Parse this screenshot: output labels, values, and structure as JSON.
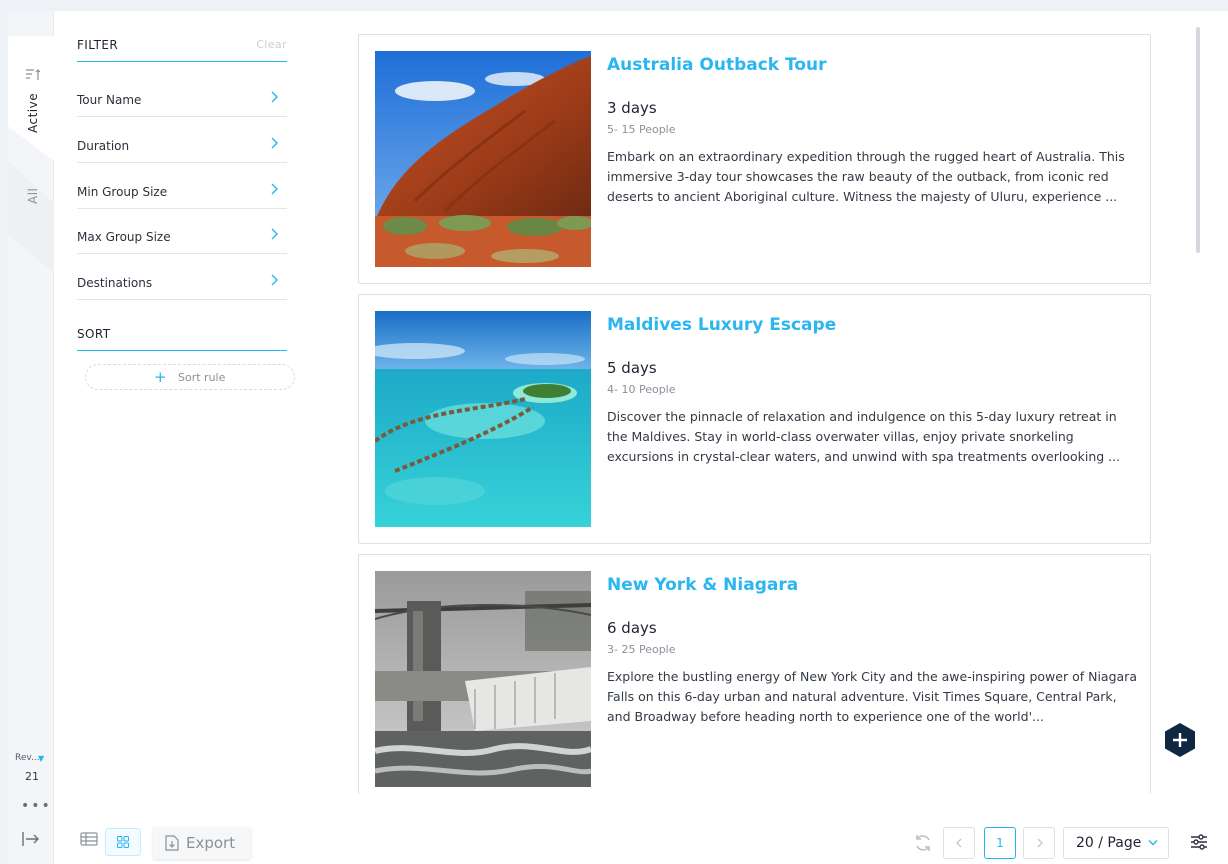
{
  "rail": {
    "tab_active": "Active",
    "tab_all": "All",
    "rev_label": "Rev...",
    "rev_value": "21",
    "more": "•••"
  },
  "filter": {
    "heading": "FILTER",
    "clear": "Clear",
    "items": [
      {
        "label": "Tour Name"
      },
      {
        "label": "Duration"
      },
      {
        "label": "Min Group Size"
      },
      {
        "label": "Max Group Size"
      },
      {
        "label": "Destinations"
      }
    ]
  },
  "sort": {
    "heading": "SORT",
    "add_rule": "Sort rule"
  },
  "tours": [
    {
      "title": "Australia Outback Tour",
      "duration": "3 days",
      "group": "5- 15 People",
      "description": "Embark on an extraordinary expedition through the rugged heart of Australia. This immersive 3-day tour showcases the raw beauty of the outback, from iconic red deserts to ancient Aboriginal culture. Witness the majesty of Uluru, experience ..."
    },
    {
      "title": "Maldives Luxury Escape",
      "duration": "5 days",
      "group": "4- 10 People",
      "description": "Discover the pinnacle of relaxation and indulgence on this 5-day luxury retreat in the Maldives. Stay in world-class overwater villas, enjoy private snorkeling excursions in crystal-clear waters, and unwind with spa treatments overlooking ..."
    },
    {
      "title": "New York & Niagara",
      "duration": "6 days",
      "group": "3- 25 People",
      "description": "Explore the bustling energy of New York City and the awe-inspiring power of Niagara Falls on this 6-day urban and natural adventure. Visit Times Square, Central Park, and Broadway before heading north to experience one of the world'..."
    }
  ],
  "footer": {
    "export": "Export",
    "current_page": "1",
    "page_size": "20 / Page"
  },
  "colors": {
    "accent": "#20b7f0",
    "fab": "#0f2742"
  }
}
